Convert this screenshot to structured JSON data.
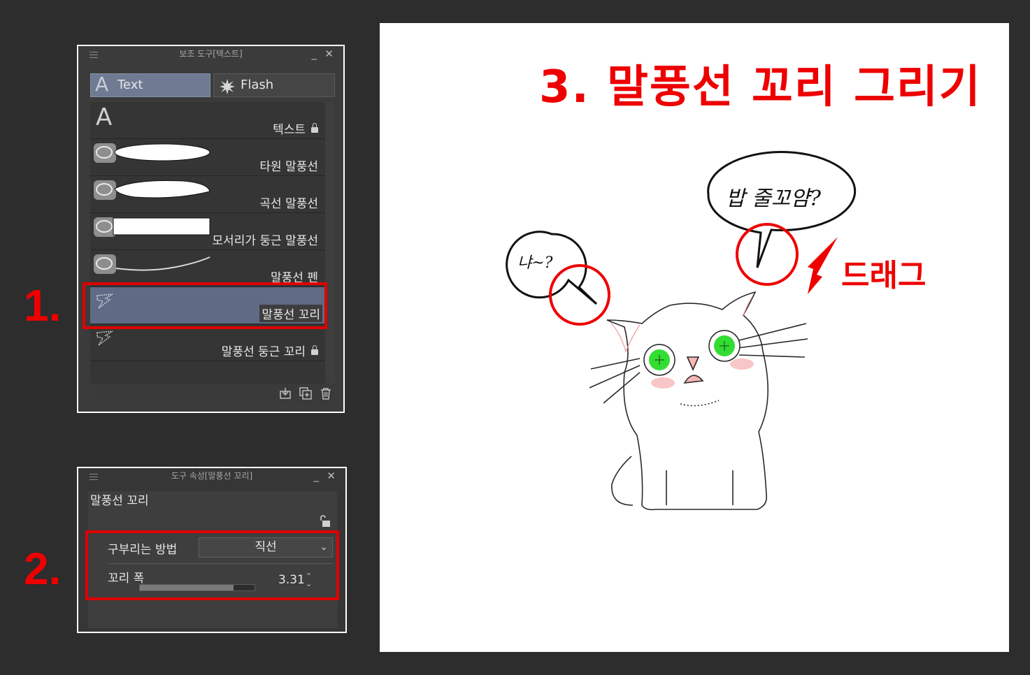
{
  "sub_tool_panel": {
    "title": "보조 도구[텍스트]",
    "tabs": [
      {
        "label": "Text",
        "icon": "text-a-icon",
        "active": true
      },
      {
        "label": "Flash",
        "icon": "flash-burst-icon",
        "active": false
      }
    ],
    "items": [
      {
        "label": "텍스트",
        "icon": "text-a-icon",
        "locked": true
      },
      {
        "label": "타원 말풍선",
        "icon": "ellipse-balloon-icon",
        "locked": false
      },
      {
        "label": "곡선 말풍선",
        "icon": "curve-balloon-icon",
        "locked": false
      },
      {
        "label": "모서리가 둥근 말풍선",
        "icon": "rounded-rect-balloon-icon",
        "locked": false
      },
      {
        "label": "말풍선 펜",
        "icon": "balloon-pen-icon",
        "locked": false
      },
      {
        "label": "말풍선 꼬리",
        "icon": "balloon-tail-icon",
        "locked": false,
        "selected": true
      },
      {
        "label": "말풍선 둥근 꼬리",
        "icon": "balloon-round-tail-icon",
        "locked": true
      }
    ],
    "footer_icons": [
      "import-icon",
      "duplicate-icon",
      "trash-icon"
    ]
  },
  "tool_property_panel": {
    "title": "도구 속성[말풍선 꼬리]",
    "tool_name": "말풍선 꼬리",
    "bend_method_label": "구부리는 방법",
    "bend_method_value": "직선",
    "tail_width_label": "꼬리 폭",
    "tail_width_value": "3.31",
    "tail_width_fraction": 0.82
  },
  "steps": {
    "step1": "1.",
    "step2": "2."
  },
  "canvas": {
    "headline": "3. 말풍선 꼬리 그리기",
    "drag_label": "드래그",
    "bubble_left_text": "냐~?",
    "bubble_right_text": "밥 줄꼬얌?"
  },
  "colors": {
    "highlight": "#ee0000",
    "selected_item": "#5f6b85",
    "cat_eye": "#33dd33",
    "cat_blush": "#f6b8b8"
  }
}
